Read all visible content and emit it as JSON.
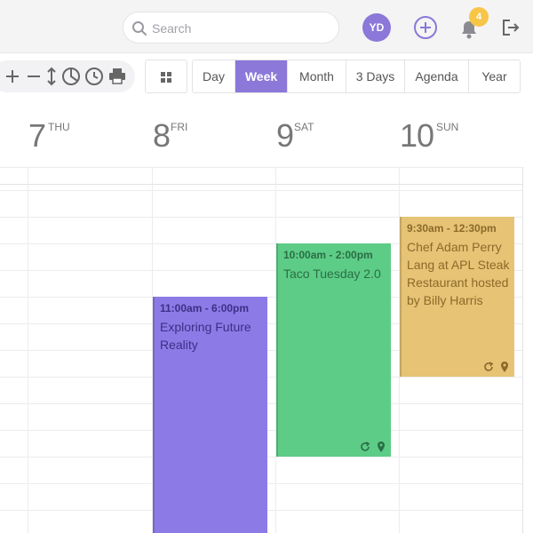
{
  "header": {
    "search_placeholder": "Search",
    "avatar_initials": "YD",
    "notification_count": "4",
    "accent_color": "#8b78d8"
  },
  "toolbar": {
    "tools": [
      "zoom-in-icon",
      "zoom-out-icon",
      "resize-vertical-icon",
      "pie-chart-icon",
      "clock-icon",
      "print-icon"
    ],
    "grid_icon": "grid-icon"
  },
  "views": [
    {
      "label": "Day",
      "active": false
    },
    {
      "label": "Week",
      "active": true
    },
    {
      "label": "Month",
      "active": false
    },
    {
      "label": "3 Days",
      "active": false
    },
    {
      "label": "Agenda",
      "active": false
    },
    {
      "label": "Year",
      "active": false
    }
  ],
  "days": [
    {
      "num": "7",
      "dow": "THU"
    },
    {
      "num": "8",
      "dow": "FRI"
    },
    {
      "num": "9",
      "dow": "SAT"
    },
    {
      "num": "10",
      "dow": "SUN"
    }
  ],
  "events": [
    {
      "time": "11:00am - 6:00pm",
      "title": "Exploring Future Reality",
      "color": "#8c7be6"
    },
    {
      "time": "10:00am - 2:00pm",
      "title": "Taco Tuesday 2.0",
      "color": "#5dcc87"
    },
    {
      "time": "9:30am - 12:30pm",
      "title": "Chef Adam Perry Lang at APL Steak Restaurant hosted by Billy Harris",
      "color": "#e6c375"
    }
  ]
}
